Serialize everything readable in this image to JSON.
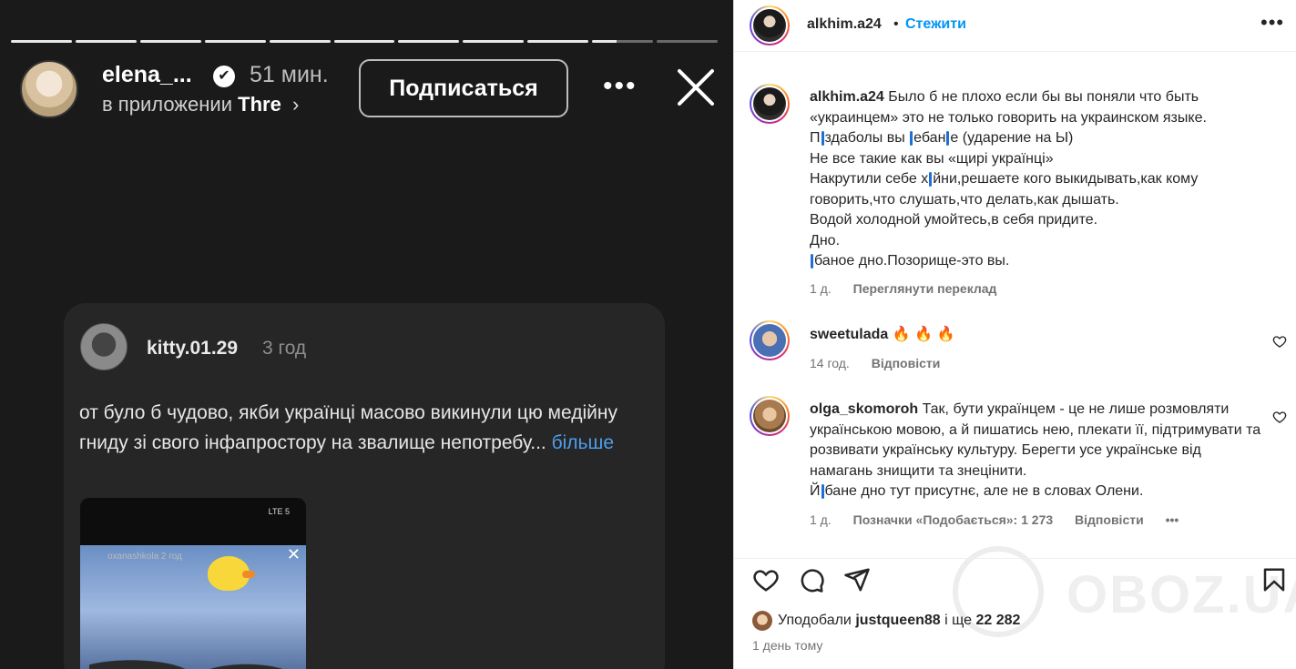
{
  "story": {
    "username": "elena_...",
    "verified_icon": "✔",
    "time": "51 мин.",
    "subtitle_prefix": "в приложении",
    "subtitle_app": "Thre",
    "subscribe_label": "Подписаться",
    "more_label": "•••",
    "card": {
      "username": "kitty.01.29",
      "time": "3 год",
      "text": "от було б чудово, якби українці масово викинули цю медійну гниду зі свого інфапростору на звалище непотребу...",
      "more": "більше",
      "shot_status": "LTE 5",
      "shot_user": "oxanashkola 2 год",
      "shot_close": "✕"
    }
  },
  "post": {
    "header": {
      "username": "alkhim.a24",
      "dot": "•",
      "follow_label": "Стежити",
      "more_label": "•••"
    },
    "caption": {
      "username": "alkhim.a24",
      "line1": "Было б не плохо если бы вы поняли что быть «украинцем» это не только говорить на украинском языке.",
      "line2a": "П",
      "line2b": "здаболы вы ",
      "line2c": "ебан",
      "line2d": "е (ударение на Ы)",
      "line3": "Не все такие как вы «щирі українці»",
      "line4a": "Накрутили себе х",
      "line4b": "йни,решаете кого выкидывать,как кому говорить,что слушать,что делать,как дышать.",
      "line5": "Водой холодной умойтесь,в себя придите.",
      "line6": "Дно.",
      "line7": "баное дно.Позорище-это вы.",
      "time": "1 д.",
      "translate": "Переглянути переклад"
    },
    "comments": [
      {
        "username": "sweetulada",
        "text": "🔥 🔥 🔥",
        "time": "14 год.",
        "reply": "Відповісти"
      },
      {
        "username": "olga_skomoroh",
        "text": "Так, бути українцем - це не лише розмовляти українською мовою, а й пишатись нею, плекати її, підтримувати та розвивати українську культуру. Берегти усе українське від намагань знищити та знецінити.",
        "text_last_a": "Й",
        "text_last_b": "бане дно тут присутнє, але не в словах Олени.",
        "time": "1 д.",
        "likes": "Позначки «Подобається»: 1 273",
        "reply": "Відповісти",
        "more": "•••"
      }
    ],
    "likes": {
      "prefix": "Уподобали",
      "user": "justqueen88",
      "middle": "і ще",
      "count": "22 282"
    },
    "date": "1 день тому",
    "watermark": "OBOZ.UA"
  },
  "icons": {
    "heart": "heart-icon",
    "comment": "comment-icon",
    "share": "send-icon",
    "save": "bookmark-icon",
    "close": "close-icon",
    "verified": "verified-badge-icon"
  },
  "colors": {
    "follow_blue": "#0095f6",
    "link_blue": "#4d9fec",
    "censor_blue": "#1e6fd9"
  }
}
